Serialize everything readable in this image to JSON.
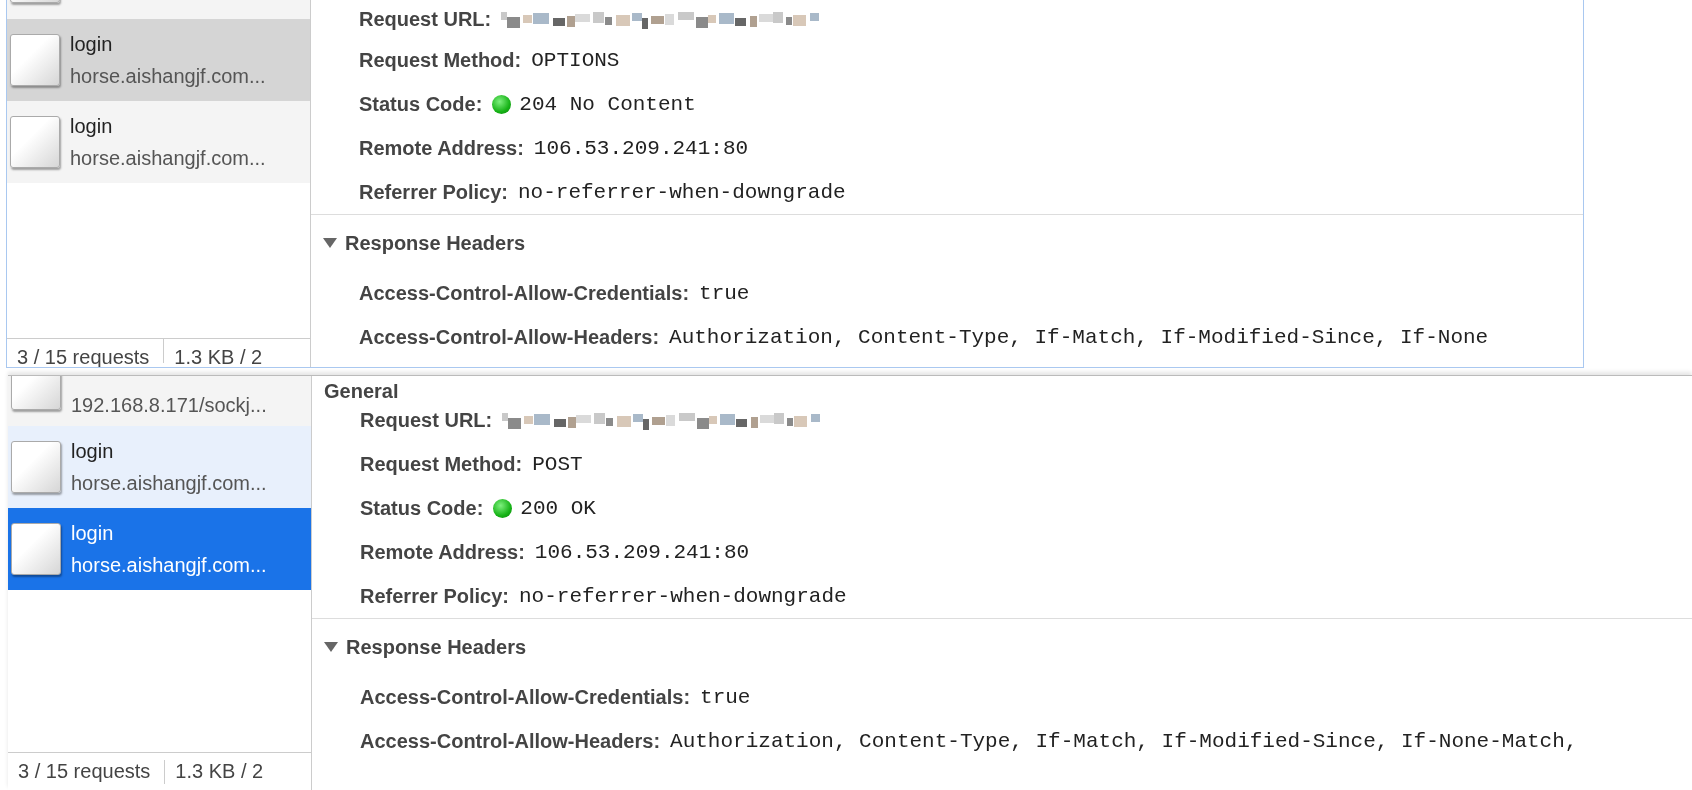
{
  "panels": [
    {
      "focused": false,
      "requests": [
        {
          "kind": "cut",
          "selected": false,
          "hovered": false
        },
        {
          "kind": "full",
          "name": "login",
          "domain": "horse.aishangjf.com...",
          "selected": true,
          "hovered": false
        },
        {
          "kind": "full",
          "name": "login",
          "domain": "horse.aishangjf.com...",
          "selected": false,
          "hovered": false
        }
      ],
      "footer": {
        "count": "3 / 15 requests",
        "size": "1.3 KB / 2"
      },
      "general": {
        "fields": [
          {
            "kind": "redacted",
            "label": "Request URL:"
          },
          {
            "kind": "text",
            "label": "Request Method:",
            "value": "OPTIONS"
          },
          {
            "kind": "status",
            "label": "Status Code:",
            "value": "204 No Content"
          },
          {
            "kind": "text",
            "label": "Remote Address:",
            "value": "106.53.209.241:80"
          },
          {
            "kind": "text",
            "label": "Referrer Policy:",
            "value": "no-referrer-when-downgrade"
          }
        ]
      },
      "response_headers": {
        "heading": "Response Headers",
        "expanded": true,
        "fields": [
          {
            "kind": "text",
            "label": "Access-Control-Allow-Credentials:",
            "value": "true"
          },
          {
            "kind": "text",
            "label": "Access-Control-Allow-Headers:",
            "value": "Authorization, Content-Type, If-Match, If-Modified-Since, If-None"
          }
        ]
      }
    },
    {
      "focused": true,
      "requests": [
        {
          "kind": "cut",
          "domain": "192.168.8.171/sockj...",
          "selected": false,
          "hovered": false
        },
        {
          "kind": "full",
          "name": "login",
          "domain": "horse.aishangjf.com...",
          "selected": false,
          "hovered": true
        },
        {
          "kind": "full",
          "name": "login",
          "domain": "horse.aishangjf.com...",
          "selected": true,
          "hovered": false
        }
      ],
      "footer": {
        "count": "3 / 15 requests",
        "size": "1.3 KB / 2"
      },
      "general": {
        "heading": "General",
        "fields": [
          {
            "kind": "redacted",
            "label": "Request URL:"
          },
          {
            "kind": "text",
            "label": "Request Method:",
            "value": "POST"
          },
          {
            "kind": "status",
            "label": "Status Code:",
            "value": "200 OK"
          },
          {
            "kind": "text",
            "label": "Remote Address:",
            "value": "106.53.209.241:80"
          },
          {
            "kind": "text",
            "label": "Referrer Policy:",
            "value": "no-referrer-when-downgrade"
          }
        ]
      },
      "response_headers": {
        "heading": "Response Headers",
        "expanded": true,
        "fields": [
          {
            "kind": "text",
            "label": "Access-Control-Allow-Credentials:",
            "value": "true"
          },
          {
            "kind": "text",
            "label": "Access-Control-Allow-Headers:",
            "value": "Authorization, Content-Type, If-Match, If-Modified-Since, If-None-Match,"
          }
        ]
      }
    }
  ]
}
